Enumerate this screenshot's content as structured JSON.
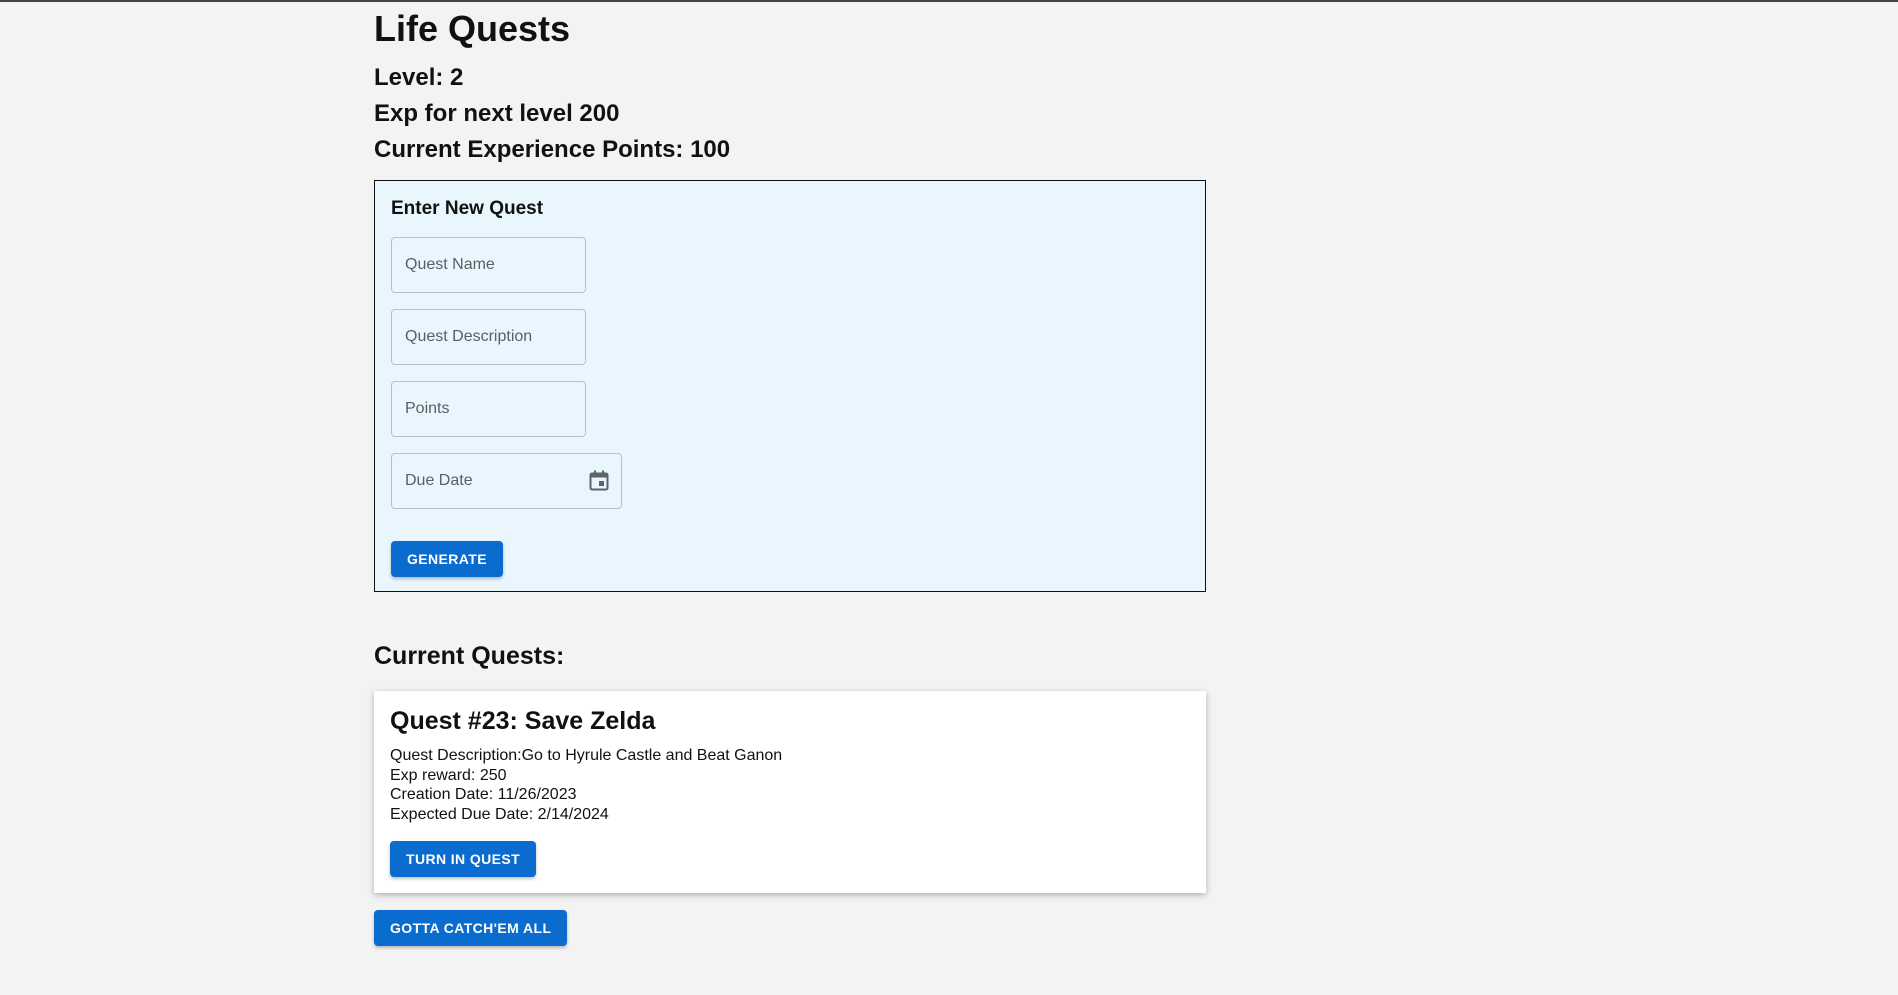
{
  "app": {
    "title": "Life Quests"
  },
  "stats": {
    "level": "Level: 2",
    "exp_next": "Exp for next level 200",
    "current_exp": "Current Experience Points: 100"
  },
  "form": {
    "title": "Enter New Quest",
    "quest_name": {
      "placeholder": "Quest Name",
      "value": ""
    },
    "quest_description": {
      "placeholder": "Quest Description",
      "value": ""
    },
    "points": {
      "placeholder": "Points",
      "value": ""
    },
    "due_date": {
      "placeholder": "Due Date",
      "value": "",
      "icon": "calendar-icon"
    },
    "generate_label": "GENERATE"
  },
  "current_quests": {
    "title": "Current Quests:",
    "items": [
      {
        "heading": "Quest #23: Save Zelda",
        "description": "Quest Description:Go to Hyrule Castle and Beat Ganon",
        "exp_reward": "Exp reward: 250",
        "creation_date": "Creation Date: 11/26/2023",
        "due_date": "Expected Due Date: 2/14/2024",
        "turn_in_label": "TURN IN QUEST"
      }
    ]
  },
  "footer": {
    "catch_all_label": "GOTTA CATCH'EM ALL"
  },
  "colors": {
    "background": "#f3f3f3",
    "panel": "#eaf6fe",
    "accent": "#0b6ccf"
  }
}
